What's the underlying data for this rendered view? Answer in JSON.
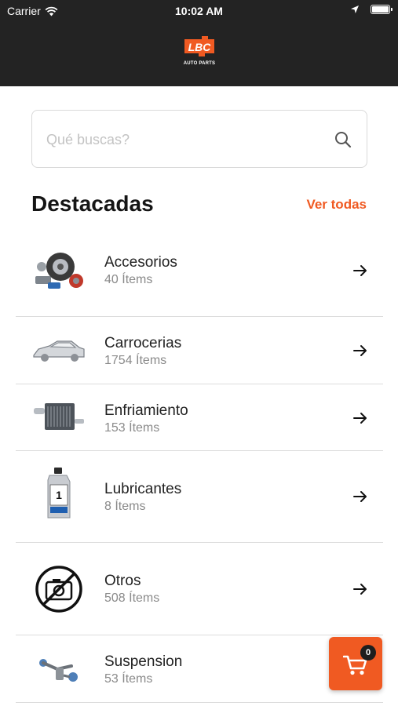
{
  "status_bar": {
    "carrier": "Carrier",
    "time": "10:02 AM"
  },
  "brand": {
    "logo_text": "LBC",
    "logo_subtext": "AUTO PARTS",
    "accent_color": "#f05a22",
    "header_color": "#232323"
  },
  "search": {
    "placeholder": "Qué buscas?",
    "value": ""
  },
  "featured": {
    "title": "Destacadas",
    "see_all_label": "Ver todas",
    "items": [
      {
        "name": "Accesorios",
        "count": "40 Ítems",
        "icon": "wheel-parts-icon"
      },
      {
        "name": "Carrocerias",
        "count": "1754 Ítems",
        "icon": "car-body-icon"
      },
      {
        "name": "Enfriamiento",
        "count": "153 Ítems",
        "icon": "radiator-icon"
      },
      {
        "name": "Lubricantes",
        "count": "8 Ítems",
        "icon": "oil-bottle-icon"
      },
      {
        "name": "Otros",
        "count": "508 Ítems",
        "icon": "no-camera-icon"
      },
      {
        "name": "Suspension",
        "count": "53 Ítems",
        "icon": "suspension-icon"
      }
    ]
  },
  "cart": {
    "badge_count": "0"
  }
}
